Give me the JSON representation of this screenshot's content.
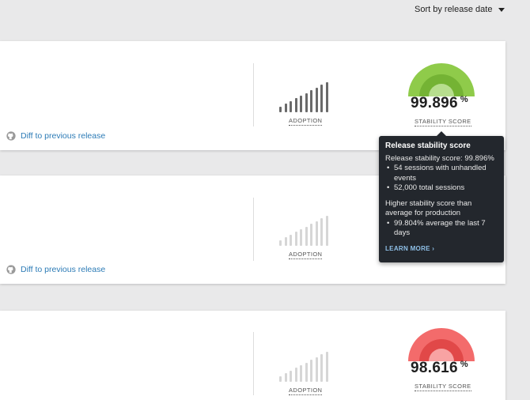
{
  "sort": {
    "label": "Sort by release date"
  },
  "releases": [
    {
      "diff_label": "Diff to previous release",
      "adoption_label": "ADOPTION",
      "adoption_bars": [
        1,
        2,
        3,
        4,
        5,
        6,
        7,
        8,
        9,
        10
      ],
      "bar_color": "#6a6a6a",
      "stability_score": "99.896",
      "stability_unit": "%",
      "stability_label": "STABILITY SCORE",
      "gauge_colors": {
        "outer": "#8fcb4a",
        "mid": "#74b334",
        "inner": "#b7de8e"
      }
    },
    {
      "diff_label": "Diff to previous release",
      "adoption_label": "ADOPTION",
      "adoption_bars": [
        1,
        2,
        3,
        4,
        5,
        6,
        7,
        8,
        9,
        10
      ],
      "bar_color": "#d6d6d6"
    },
    {
      "adoption_label": "ADOPTION",
      "adoption_bars": [
        1,
        2,
        3,
        4,
        5,
        6,
        7,
        8,
        9,
        10
      ],
      "bar_color": "#d6d6d6",
      "stability_score": "98.616",
      "stability_unit": "%",
      "stability_label": "STABILITY SCORE",
      "gauge_colors": {
        "outer": "#f36b6b",
        "mid": "#e14848",
        "inner": "#f8a3a3"
      }
    }
  ],
  "tooltip": {
    "title": "Release stability score",
    "score_line": "Release stability score: 99.896%",
    "items": [
      "54 sessions with unhandled events",
      "52,000 total sessions"
    ],
    "comparison": "Higher stability score than average for production",
    "comparison_items": [
      "99.804% average the last 7 days"
    ],
    "learn_more": "LEARN MORE ›"
  },
  "icons": {
    "github": "github-icon",
    "caret": "caret-down-icon"
  }
}
